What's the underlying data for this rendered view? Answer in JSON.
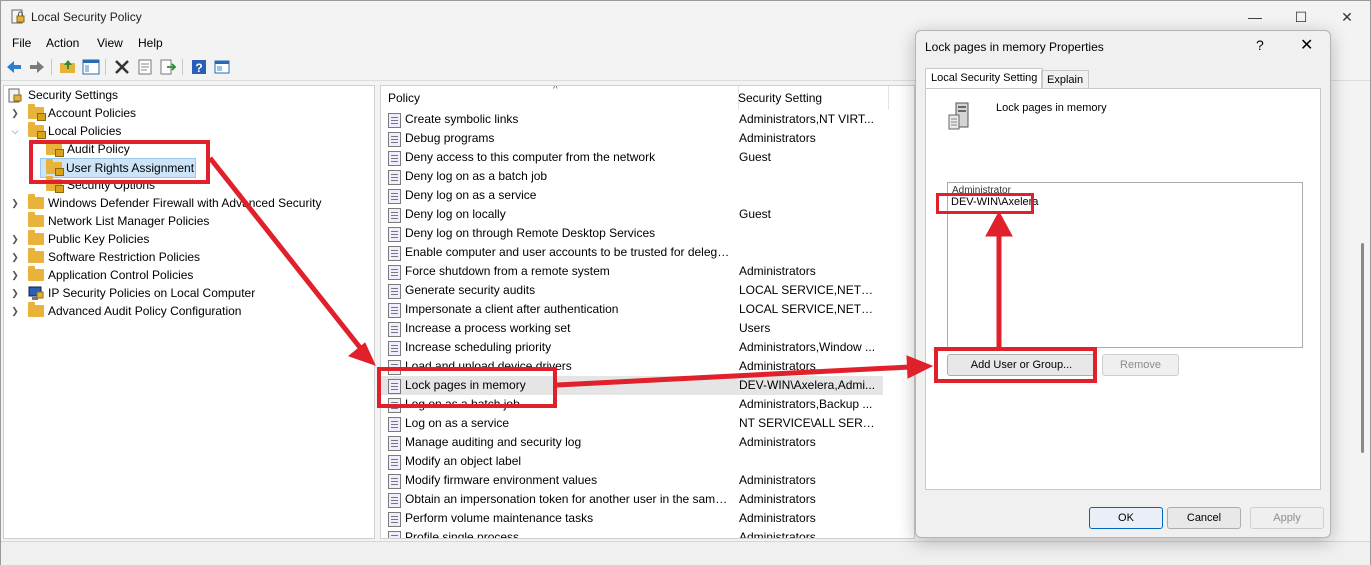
{
  "app": {
    "title": "Local Security Policy",
    "window_controls": {
      "minimize": "—",
      "maximize": "☐",
      "close": "✕"
    }
  },
  "menu": [
    "File",
    "Action",
    "View",
    "Help"
  ],
  "toolbar_icons": [
    "back-icon",
    "forward-icon",
    "up-folder-icon",
    "show-hide-tree-icon",
    "delete-icon",
    "properties-icon",
    "export-icon",
    "help-icon",
    "console-icon"
  ],
  "tree": {
    "root": "Security Settings",
    "items": [
      {
        "label": "Account Policies",
        "level": 1,
        "expanded": false
      },
      {
        "label": "Local Policies",
        "level": 1,
        "expanded": true
      },
      {
        "label": "Audit Policy",
        "level": 2,
        "expanded": false
      },
      {
        "label": "User Rights Assignment",
        "level": 2,
        "expanded": false,
        "selected": true
      },
      {
        "label": "Security Options",
        "level": 2,
        "expanded": false
      },
      {
        "label": "Windows Defender Firewall with Advanced Security",
        "level": 1,
        "expanded": false
      },
      {
        "label": "Network List Manager Policies",
        "level": 1,
        "expanded": false
      },
      {
        "label": "Public Key Policies",
        "level": 1,
        "expanded": false
      },
      {
        "label": "Software Restriction Policies",
        "level": 1,
        "expanded": false
      },
      {
        "label": "Application Control Policies",
        "level": 1,
        "expanded": false
      },
      {
        "label": "IP Security Policies on Local Computer",
        "level": 1,
        "expanded": false
      },
      {
        "label": "Advanced Audit Policy Configuration",
        "level": 1,
        "expanded": false
      }
    ]
  },
  "list": {
    "columns": [
      "Policy",
      "Security Setting"
    ],
    "sort_indicator": "^",
    "rows": [
      {
        "policy": "Create symbolic links",
        "setting": "Administrators,NT VIRT..."
      },
      {
        "policy": "Debug programs",
        "setting": "Administrators"
      },
      {
        "policy": "Deny access to this computer from the network",
        "setting": "Guest"
      },
      {
        "policy": "Deny log on as a batch job",
        "setting": ""
      },
      {
        "policy": "Deny log on as a service",
        "setting": ""
      },
      {
        "policy": "Deny log on locally",
        "setting": "Guest"
      },
      {
        "policy": "Deny log on through Remote Desktop Services",
        "setting": ""
      },
      {
        "policy": "Enable computer and user accounts to be trusted for delega...",
        "setting": ""
      },
      {
        "policy": "Force shutdown from a remote system",
        "setting": "Administrators"
      },
      {
        "policy": "Generate security audits",
        "setting": "LOCAL SERVICE,NETWO..."
      },
      {
        "policy": "Impersonate a client after authentication",
        "setting": "LOCAL SERVICE,NETWO..."
      },
      {
        "policy": "Increase a process working set",
        "setting": "Users"
      },
      {
        "policy": "Increase scheduling priority",
        "setting": "Administrators,Window ..."
      },
      {
        "policy": "Load and unload device drivers",
        "setting": "Administrators"
      },
      {
        "policy": "Lock pages in memory",
        "setting": "DEV-WIN\\Axelera,Admi...",
        "highlight": true
      },
      {
        "policy": "Log on as a batch job",
        "setting": "Administrators,Backup ..."
      },
      {
        "policy": "Log on as a service",
        "setting": "NT SERVICE\\ALL SERVIC..."
      },
      {
        "policy": "Manage auditing and security log",
        "setting": "Administrators"
      },
      {
        "policy": "Modify an object label",
        "setting": ""
      },
      {
        "policy": "Modify firmware environment values",
        "setting": "Administrators"
      },
      {
        "policy": "Obtain an impersonation token for another user in the same...",
        "setting": "Administrators"
      },
      {
        "policy": "Perform volume maintenance tasks",
        "setting": "Administrators"
      },
      {
        "policy": "Profile single process",
        "setting": "Administrators"
      }
    ]
  },
  "dialog": {
    "title": "Lock pages in memory Properties",
    "help": "?",
    "close": "✕",
    "tabs": [
      "Local Security Setting",
      "Explain"
    ],
    "policy_name": "Lock pages in memory",
    "group_label": "Administrator",
    "member": "DEV-WIN\\Axelera",
    "add_button": "Add User or Group...",
    "remove_button": "Remove",
    "ok_button": "OK",
    "cancel_button": "Cancel",
    "apply_button": "Apply"
  },
  "annotation_color": "#e0202a"
}
